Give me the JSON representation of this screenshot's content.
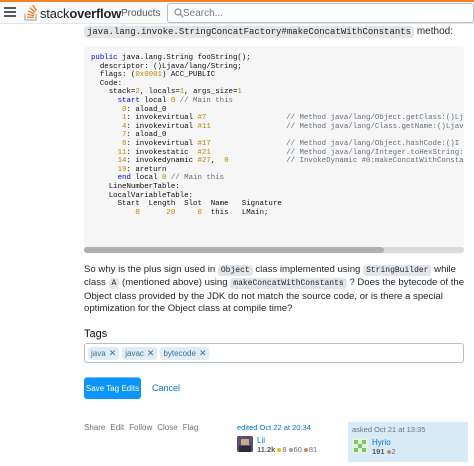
{
  "header": {
    "logo_light": "stack",
    "logo_bold": "overflow",
    "nav_products": "Products",
    "search_placeholder": "Search..."
  },
  "intro": {
    "code": "java.lang.invoke.StringConcatFactory#makeConcatWithConstants",
    "suffix": " method:"
  },
  "code_lines": [
    "public java.lang.String fooString();",
    "  descriptor: ()Ljava/lang/String;",
    "  flags: (0x0001) ACC_PUBLIC",
    "  Code:",
    "    stack=2, locals=1, args_size=1",
    "      start local 0 // Main this",
    "       0: aload_0",
    "       1: invokevirtual #7                  // Method java/lang/Object.getClass:()Ljava/l",
    "       4: invokevirtual #11                 // Method java/lang/Class.getName:()Ljava/lan",
    "       7: aload_0",
    "       8: invokevirtual #17                 // Method java/lang/Object.hashCode:()I",
    "      11: invokestatic  #21                 // Method java/lang/Integer.toHexString:(I)Lj",
    "      14: invokedynamic #27,  0             // InvokeDynamic #0:makeConcatWithConstants:(",
    "      19: areturn",
    "      end local 0 // Main this",
    "    LineNumberTable:",
    "    LocalVariableTable:",
    "      Start  Length  Slot  Name   Signature",
    "          0      20     0  this   LMain;"
  ],
  "question": {
    "p1": "So why is the plus sign used in ",
    "c1": "Object",
    "p2": " class implemented using ",
    "c2": "StringBuilder",
    "p3": " while class ",
    "c3": "A",
    "p4": " (mentioned above) using ",
    "c4": "makeConcatWithConstants",
    "p5": " ? Does the bytecode of the Object class provided by the JDK do not match the source code, or is there a special optimization for the Object class at compile time?"
  },
  "tags": {
    "label": "Tags",
    "items": [
      "java",
      "javac",
      "bytecode"
    ]
  },
  "actions": {
    "save": "Save Tag Edits",
    "cancel": "Cancel"
  },
  "post_menu": [
    "Share",
    "Edit",
    "Follow",
    "Close",
    "Flag"
  ],
  "editor": {
    "action": "edited Oct 22 at 20:34",
    "name": "Lii",
    "reputation": "11.2k",
    "gold": "8",
    "silver": "60",
    "bronze": "81"
  },
  "owner": {
    "action": "asked Oct 21 at 13:35",
    "name": "Hyrio",
    "reputation": "191",
    "bronze": "2"
  },
  "colors": {
    "accent": "#f48225",
    "primary": "#0a95ff",
    "link": "#0074cc",
    "tag_bg": "#e1ecf4",
    "tag_fg": "#39739d",
    "gold": "#f1b600",
    "silver": "#9a9fa4",
    "bronze": "#c38b5f"
  }
}
